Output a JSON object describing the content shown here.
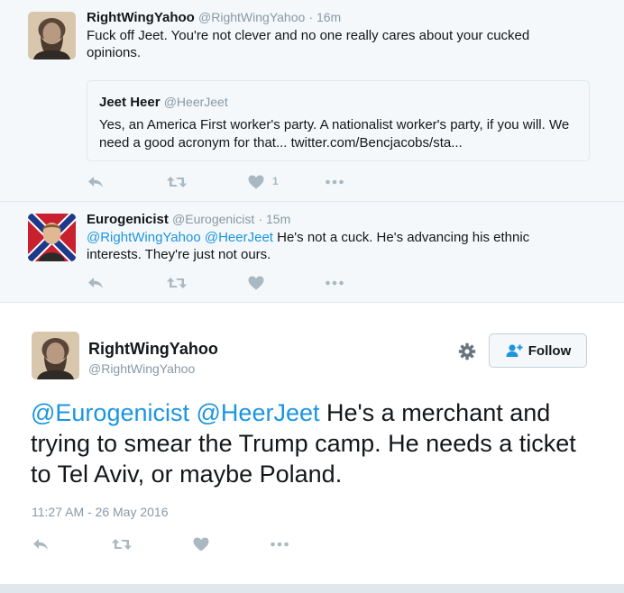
{
  "reply1": {
    "name": "RightWingYahoo",
    "handle": "@RightWingYahoo",
    "time": "· 16m",
    "text": "Fuck off Jeet. You're not clever and no one really cares about your cucked opinions.",
    "quote": {
      "name": "Jeet Heer",
      "handle": "@HeerJeet",
      "text": "Yes, an America First worker's party. A nationalist worker's party, if you will. We need a good acronym for that... twitter.com/Bencjacobs/sta..."
    },
    "like_count": "1"
  },
  "reply2": {
    "name": "Eurogenicist",
    "handle": "@Eurogenicist",
    "time": "· 15m",
    "mention1": "@RightWingYahoo",
    "mention2": "@HeerJeet",
    "text": "He's not a cuck. He's advancing his ethnic interests. They're just not ours."
  },
  "main": {
    "name": "RightWingYahoo",
    "handle": "@RightWingYahoo",
    "follow_label": "Follow",
    "mention1": "@Eurogenicist",
    "mention2": "@HeerJeet",
    "text": "He's a merchant and trying to smear the Trump camp. He needs a ticket to Tel Aviv, or maybe Poland.",
    "timestamp": "11:27 AM - 26 May 2016"
  },
  "colors": {
    "link": "#1b95e0",
    "muted": "#8899a6",
    "icon": "#aab8c2",
    "reply_bg": "#f5f8fa"
  },
  "icons": [
    "reply-icon",
    "retweet-icon",
    "like-icon",
    "more-icon",
    "gear-icon",
    "follow-person-icon"
  ]
}
